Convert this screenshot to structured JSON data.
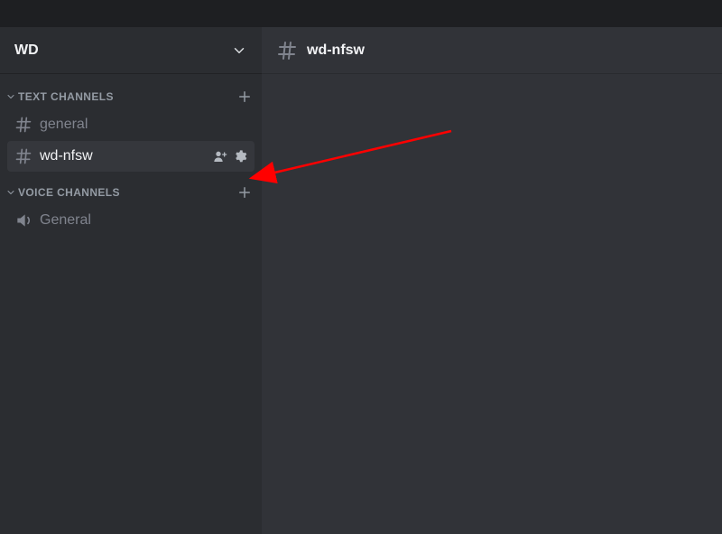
{
  "server": {
    "name": "WD"
  },
  "text_channels": {
    "label": "Text Channels",
    "items": [
      {
        "name": "general",
        "selected": false
      },
      {
        "name": "wd-nfsw",
        "selected": true
      }
    ]
  },
  "voice_channels": {
    "label": "Voice Channels",
    "items": [
      {
        "name": "General"
      }
    ]
  },
  "main_header": {
    "channel_name": "wd-nfsw"
  },
  "annotation": {
    "arrow_color": "#ff0000"
  }
}
